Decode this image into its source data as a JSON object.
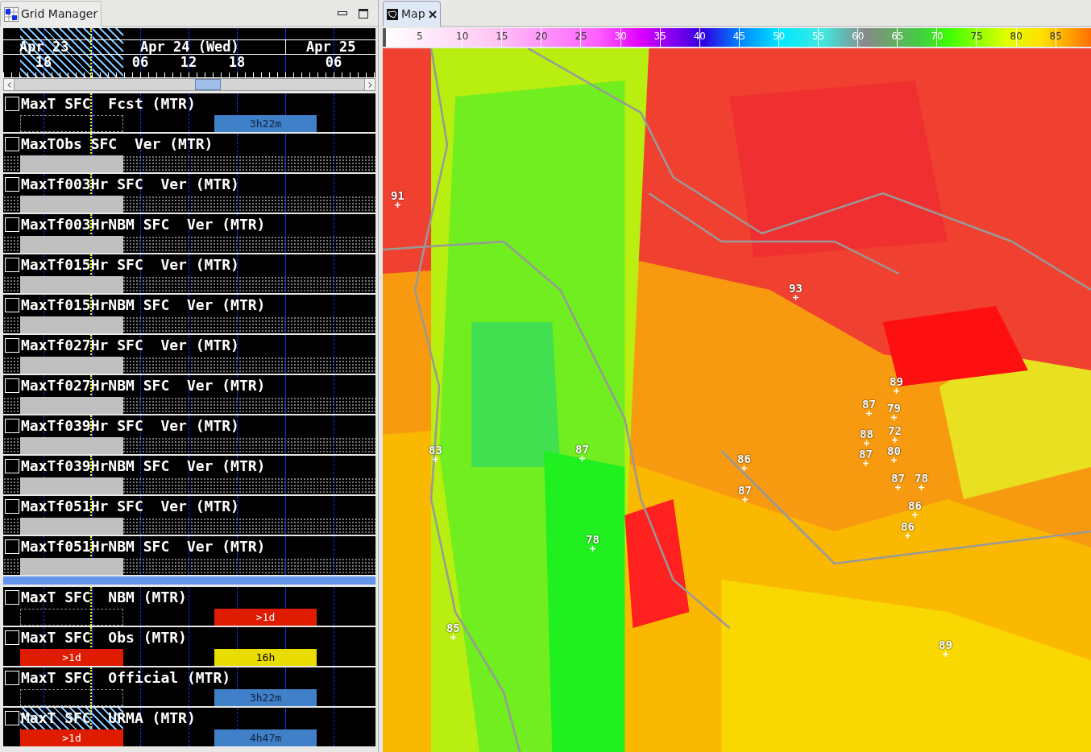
{
  "grid_manager": {
    "title": "Grid Manager",
    "timeline": {
      "dates": [
        "Apr 23",
        "Apr 24 (Wed)",
        "Apr 25"
      ],
      "hours": [
        "18",
        "06",
        "12",
        "18",
        "06"
      ]
    },
    "rows": [
      {
        "name": "MaxT SFC  Fcst (MTR)",
        "kind": "fcst",
        "checked": false,
        "hatched": false,
        "grids": [
          {
            "kind": "outline"
          },
          {
            "kind": "bar",
            "label": "3h22m",
            "color": "#4080c8"
          }
        ]
      },
      {
        "name": "MaxTObs SFC  Ver (MTR)",
        "kind": "ver",
        "checked": false,
        "hatched": false,
        "grids": [
          {
            "kind": "filled"
          }
        ]
      },
      {
        "name": "MaxTf003Hr SFC  Ver (MTR)",
        "kind": "ver",
        "checked": false,
        "hatched": false,
        "grids": [
          {
            "kind": "filled"
          }
        ]
      },
      {
        "name": "MaxTf003HrNBM SFC  Ver (MTR)",
        "kind": "ver",
        "checked": false,
        "hatched": false,
        "grids": [
          {
            "kind": "filled"
          }
        ]
      },
      {
        "name": "MaxTf015Hr SFC  Ver (MTR)",
        "kind": "ver",
        "checked": false,
        "hatched": false,
        "grids": [
          {
            "kind": "filled"
          }
        ]
      },
      {
        "name": "MaxTf015HrNBM SFC  Ver (MTR)",
        "kind": "ver",
        "checked": false,
        "hatched": false,
        "grids": [
          {
            "kind": "filled"
          }
        ]
      },
      {
        "name": "MaxTf027Hr SFC  Ver (MTR)",
        "kind": "ver",
        "checked": false,
        "hatched": false,
        "grids": [
          {
            "kind": "filled"
          }
        ]
      },
      {
        "name": "MaxTf027HrNBM SFC  Ver (MTR)",
        "kind": "ver",
        "checked": false,
        "hatched": false,
        "grids": [
          {
            "kind": "filled"
          }
        ]
      },
      {
        "name": "MaxTf039Hr SFC  Ver (MTR)",
        "kind": "ver",
        "checked": false,
        "hatched": false,
        "grids": [
          {
            "kind": "filled"
          }
        ]
      },
      {
        "name": "MaxTf039HrNBM SFC  Ver (MTR)",
        "kind": "ver",
        "checked": false,
        "hatched": false,
        "grids": [
          {
            "kind": "filled"
          }
        ]
      },
      {
        "name": "MaxTf051Hr SFC  Ver (MTR)",
        "kind": "ver",
        "checked": false,
        "hatched": false,
        "grids": [
          {
            "kind": "filled"
          }
        ]
      },
      {
        "name": "MaxTf051HrNBM SFC  Ver (MTR)",
        "kind": "ver",
        "checked": false,
        "hatched": false,
        "grids": [
          {
            "kind": "filled"
          }
        ]
      }
    ],
    "reference_rows": [
      {
        "name": "MaxT SFC  NBM (MTR)",
        "kind": "fcst",
        "checked": false,
        "hatched": false,
        "grids": [
          {
            "kind": "outline"
          },
          {
            "kind": "bar",
            "label": ">1d",
            "color": "#e01c00"
          }
        ]
      },
      {
        "name": "MaxT SFC  Obs (MTR)",
        "kind": "fcst",
        "checked": false,
        "hatched": false,
        "grids": [
          {
            "kind": "bar",
            "label": ">1d",
            "color": "#e01c00"
          },
          {
            "kind": "bar",
            "label": "16h",
            "color": "#e8dc00"
          }
        ]
      },
      {
        "name": "MaxT SFC  Official (MTR)",
        "kind": "fcst",
        "checked": false,
        "hatched": false,
        "grids": [
          {
            "kind": "outline"
          },
          {
            "kind": "bar",
            "label": "3h22m",
            "color": "#4080c8"
          }
        ]
      },
      {
        "name": "MaxT SFC  URMA (MTR)",
        "kind": "fcst",
        "checked": false,
        "hatched": true,
        "grids": [
          {
            "kind": "bar",
            "label": ">1d",
            "color": "#e01c00"
          },
          {
            "kind": "bar",
            "label": "4h47m",
            "color": "#4080c8"
          }
        ]
      }
    ]
  },
  "map": {
    "title": "Map",
    "colorbar": {
      "ticks": [
        "5",
        "10",
        "15",
        "20",
        "25",
        "30",
        "35",
        "40",
        "45",
        "50",
        "55",
        "60",
        "65",
        "70",
        "75",
        "80",
        "85"
      ]
    },
    "stations": [
      "91",
      "93",
      "89",
      "87",
      "79",
      "88",
      "72",
      "80",
      "87",
      "83",
      "87",
      "86",
      "87",
      "87",
      "78",
      "86",
      "86",
      "78",
      "85",
      "89"
    ]
  }
}
